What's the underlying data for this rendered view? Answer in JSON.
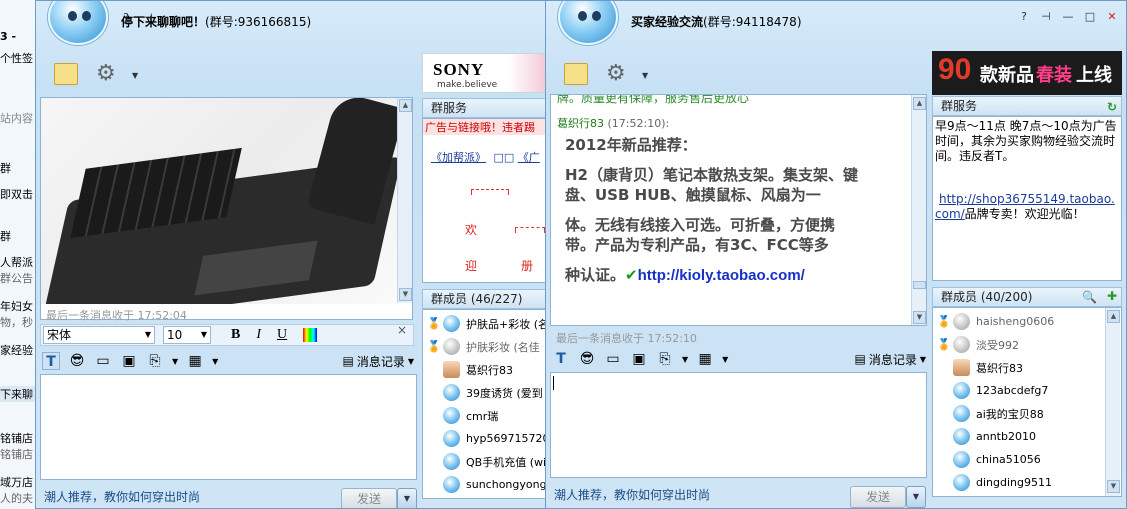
{
  "background_window": {
    "lines": [
      "3 -",
      "个性签",
      "站内容",
      "群",
      "即双击",
      "群",
      "人帮派",
      "群公告",
      "年妇女",
      "物，秒",
      "家经验",
      "下来聊",
      "铭铺店",
      "铭铺店",
      "域万店",
      "人的夫"
    ]
  },
  "window1": {
    "title": "停下来聊聊吧！",
    "group_no": "(群号:936166815)",
    "ad": {
      "brand": "SONY",
      "tagline": "make.believe"
    },
    "last_msg_tip": "最后一条消息收于  17:52:04",
    "font_name": "宋体",
    "font_size": "10",
    "format_bold": "B",
    "format_italic": "I",
    "format_underline": "U",
    "history_label": "消息记录",
    "bottom_link": "潮人推荐，教你如何穿出时尚",
    "send_label": "发送",
    "service_title": "群服务",
    "service_notice": "广告与链接哦！违者踢",
    "service_links": [
      "《加帮派》",
      "《广"
    ],
    "service_chars": [
      "欢",
      "迎",
      "册"
    ],
    "members_title": "群成员 (46/227)",
    "members": [
      {
        "name": "护肤品+彩妆 (名",
        "medal": "gold",
        "face": "blue"
      },
      {
        "name": "护肤彩妆 (名佳",
        "medal": "silver",
        "face": "gray"
      },
      {
        "name": "葛织行83",
        "medal": "none",
        "face": "girl"
      },
      {
        "name": "39度诱货 (爱到",
        "medal": "none",
        "face": "blue"
      },
      {
        "name": "cmr瑞",
        "medal": "none",
        "face": "blue"
      },
      {
        "name": "hyp569715720",
        "medal": "none",
        "face": "blue"
      },
      {
        "name": "QB手机充值 (wi",
        "medal": "none",
        "face": "blue"
      },
      {
        "name": "sunchongyongl",
        "medal": "none",
        "face": "blue"
      }
    ]
  },
  "window2": {
    "title": "买家经验交流",
    "group_no": "(群号:94118478)",
    "ad": {
      "number": "90",
      "text1": "款新品",
      "text2": "春装",
      "text3": "上线"
    },
    "top_cut_line": "牌。质量更有保障，服务售后更放心",
    "sender": "葛织行83",
    "sent_time": "(17:52:10):",
    "message": [
      "2012年新品推荐：",
      "H2（康背贝）笔记本散热支架。集支架、键",
      "盘、USB HUB、触摸鼠标、风扇为一",
      "体。无线有线接入可选。可折叠，方便携",
      "带。产品为专利产品，有3C、FCC等多",
      "种认证。"
    ],
    "link": "http://kioly.taobao.com/",
    "last_msg_tip": "最后一条消息收于  17:52:10",
    "history_label": "消息记录",
    "bottom_link": "潮人推荐，教你如何穿出时尚",
    "send_label": "发送",
    "service_title": "群服务",
    "service_text": "早9点～11点 晚7点～10点为广告时间，其余为买家购物经验交流时间。违反者T。",
    "service_link": "http://shop36755149.taobao.com/",
    "service_tail": "品牌专卖！欢迎光临！",
    "members_title": "群成员 (40/200)",
    "members": [
      {
        "name": "haisheng0606",
        "medal": "gold",
        "face": "gray"
      },
      {
        "name": "淡受992",
        "medal": "silver",
        "face": "gray"
      },
      {
        "name": "葛织行83",
        "medal": "none",
        "face": "girl"
      },
      {
        "name": "123abcdefg7",
        "medal": "none",
        "face": "blue"
      },
      {
        "name": "ai我的宝贝88",
        "medal": "none",
        "face": "blue"
      },
      {
        "name": "anntb2010",
        "medal": "none",
        "face": "blue"
      },
      {
        "name": "china51056",
        "medal": "none",
        "face": "blue"
      },
      {
        "name": "dingding9511",
        "medal": "none",
        "face": "blue"
      }
    ]
  }
}
